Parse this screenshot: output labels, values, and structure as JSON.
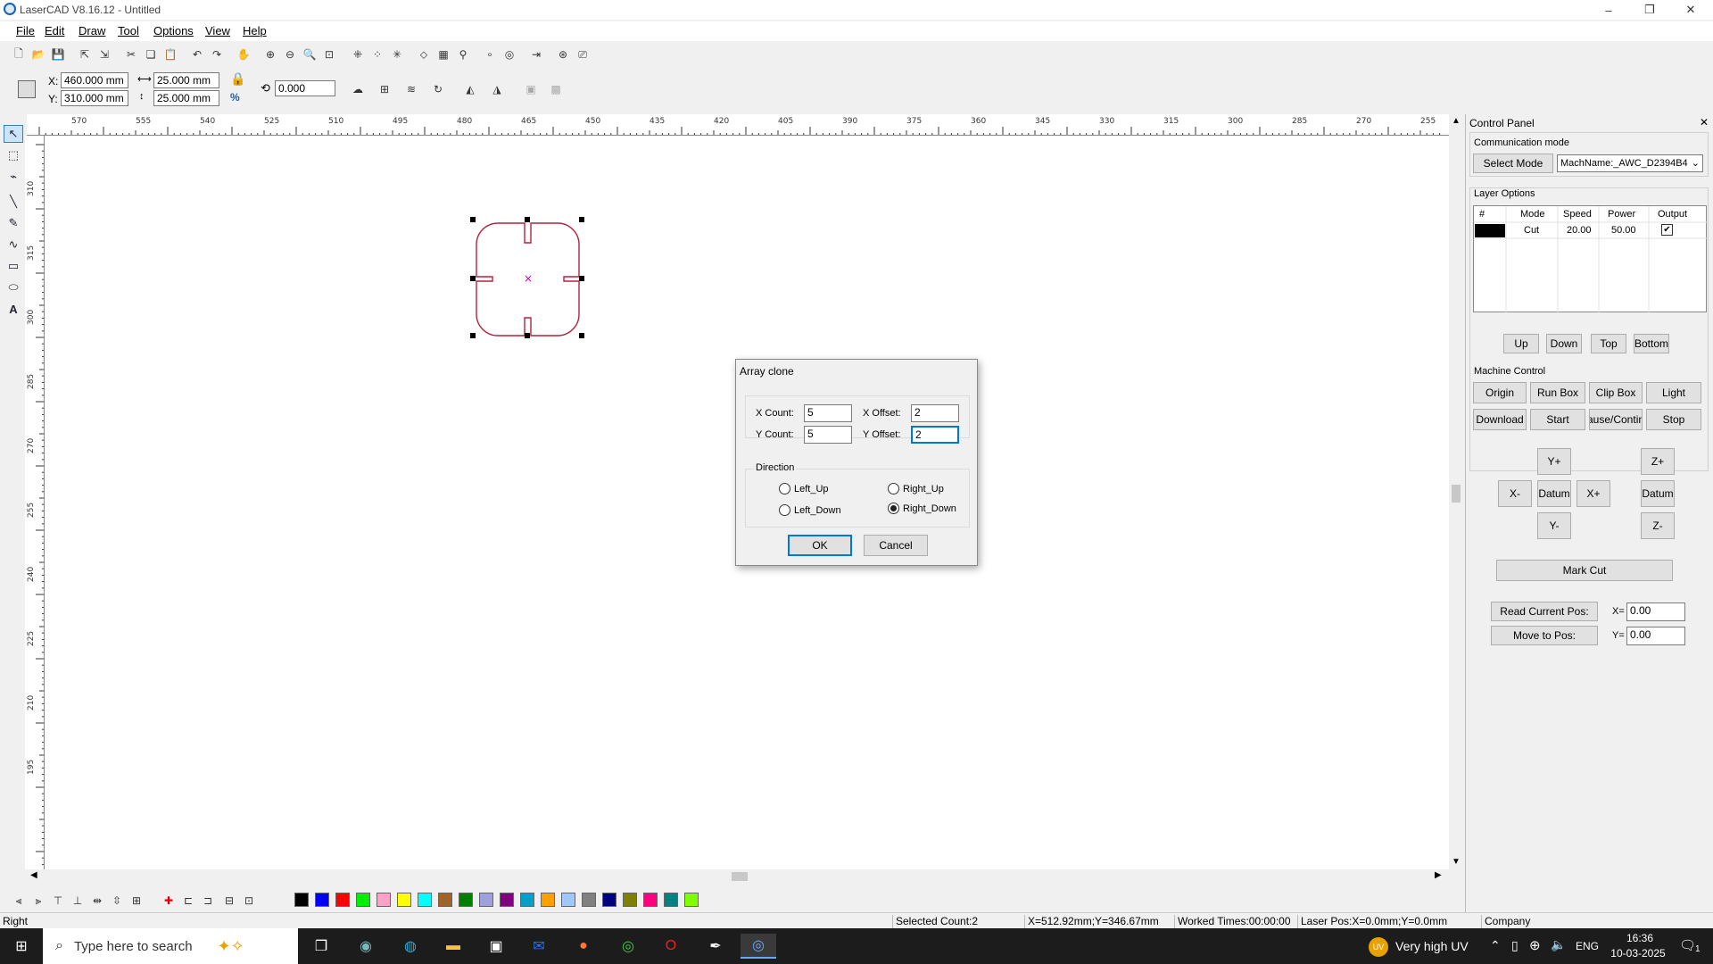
{
  "window": {
    "title": "LaserCAD V8.16.12 - Untitled",
    "min": "–",
    "restore": "❐",
    "close": "✕"
  },
  "menu": [
    "File",
    "Edit",
    "Draw",
    "Tool",
    "Options",
    "View",
    "Help"
  ],
  "props": {
    "x_label": "X:",
    "x_value": "460.000 mm",
    "y_label": "Y:",
    "y_value": "310.000 mm",
    "w_value": "25.000 mm",
    "h_value": "25.000 mm",
    "angle": "0.000",
    "pct": "%"
  },
  "ruler_top": [
    "570",
    "555",
    "540",
    "525",
    "510",
    "495",
    "480",
    "465",
    "450",
    "435",
    "420",
    "405",
    "390",
    "375",
    "360",
    "345",
    "330",
    "315",
    "300",
    "285",
    "270",
    "255"
  ],
  "ruler_left": [
    "310",
    "315",
    "300",
    "285",
    "270",
    "255",
    "240",
    "225",
    "210",
    "195"
  ],
  "dialog": {
    "title": "Array clone",
    "x_count_label": "X Count:",
    "x_count": "5",
    "y_count_label": "Y Count:",
    "y_count": "5",
    "x_offset_label": "X Offset:",
    "x_offset": "2",
    "y_offset_label": "Y Offset:",
    "y_offset": "2",
    "direction_label": "Direction",
    "left_up": "Left_Up",
    "right_up": "Right_Up",
    "left_down": "Left_Down",
    "right_down": "Right_Down",
    "ok": "OK",
    "cancel": "Cancel"
  },
  "control_panel": {
    "title": "Control Panel",
    "comm_mode": "Communication mode",
    "select_mode": "Select Mode",
    "machine": "MachName:_AWC_D2394B4",
    "layer_options": "Layer Options",
    "layer_headers": [
      "#",
      "Mode",
      "Speed",
      "Power",
      "Output"
    ],
    "layer_row": {
      "mode": "Cut",
      "speed": "20.00",
      "power": "50.00",
      "output": "✔"
    },
    "layer_buttons": [
      "Up",
      "Down",
      "Top",
      "Bottom"
    ],
    "machine_control": "Machine Control",
    "mc_row1": [
      "Origin",
      "Run Box",
      "Clip Box",
      "Light"
    ],
    "mc_row2": [
      "Download",
      "Start",
      "ause/Contin",
      "Stop"
    ],
    "jog": {
      "yplus": "Y+",
      "xminus": "X-",
      "datum": "Datum",
      "xplus": "X+",
      "yminus": "Y-",
      "zplus": "Z+",
      "zdatum": "Datum",
      "zminus": "Z-"
    },
    "mark_cut": "Mark Cut",
    "read_pos": "Read Current Pos:",
    "move_pos": "Move to Pos:",
    "x_label": "X=",
    "x_val": "0.00",
    "y_label": "Y=",
    "y_val": "0.00"
  },
  "colors": [
    "#000000",
    "#0000ff",
    "#ff0000",
    "#00ee00",
    "#ffa0c8",
    "#ffff00",
    "#00ffff",
    "#a06428",
    "#008000",
    "#a0a0dc",
    "#800080",
    "#00a0c8",
    "#ffa000",
    "#a0c8ff",
    "#808080",
    "#000080",
    "#808000",
    "#ff0080",
    "#008080",
    "#80ff00"
  ],
  "status": {
    "mode": "Right",
    "selected": "Selected Count:2",
    "pos": "X=512.92mm;Y=346.67mm",
    "worked": "Worked Times:00:00:00",
    "laser": "Laser Pos:X=0.0mm;Y=0.0mm",
    "company": "Company"
  },
  "taskbar": {
    "search_placeholder": "Type here to search",
    "weather": "Very high UV",
    "lang": "ENG",
    "time": "16:36",
    "date": "10-03-2025",
    "notif": "1"
  }
}
